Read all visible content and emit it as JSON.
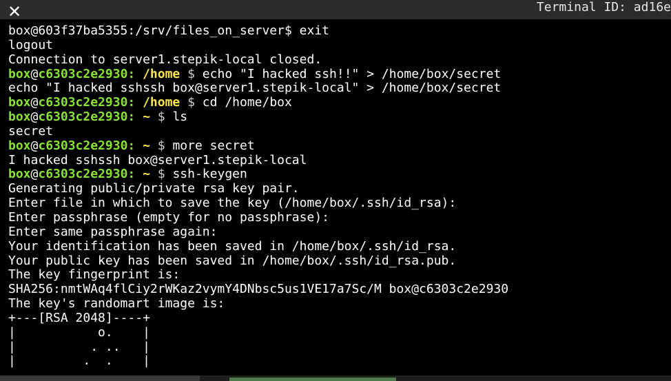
{
  "titlebar": {
    "close_symbol": "✕",
    "terminal_id": "Terminal ID: ad16e"
  },
  "terminal": {
    "lines": [
      {
        "plain": "box@603f37ba5355:/srv/files_on_server$ exit"
      },
      {
        "plain": "logout"
      },
      {
        "plain": "Connection to server1.stepik-local closed."
      },
      {
        "user": "box",
        "at": "@",
        "host": "c6303c2e2930:",
        "path": " /home",
        "sym": " $",
        "cmd": " echo \"I hacked ssh!!\" > /home/box/secret"
      },
      {
        "plain": "echo \"I hacked sshssh box@server1.stepik-local\" > /home/box/secret"
      },
      {
        "user": "box",
        "at": "@",
        "host": "c6303c2e2930:",
        "path": " /home",
        "sym": " $",
        "cmd": " cd /home/box"
      },
      {
        "user": "box",
        "at": "@",
        "host": "c6303c2e2930:",
        "path": " ~",
        "sym": " $",
        "cmd": " ls"
      },
      {
        "plain": "secret"
      },
      {
        "user": "box",
        "at": "@",
        "host": "c6303c2e2930:",
        "path": " ~",
        "sym": " $",
        "cmd": " more secret"
      },
      {
        "plain": "I hacked sshssh box@server1.stepik-local"
      },
      {
        "user": "box",
        "at": "@",
        "host": "c6303c2e2930:",
        "path": " ~",
        "sym": " $",
        "cmd": " ssh-keygen"
      },
      {
        "plain": "Generating public/private rsa key pair."
      },
      {
        "plain": "Enter file in which to save the key (/home/box/.ssh/id_rsa):"
      },
      {
        "plain": "Enter passphrase (empty for no passphrase):"
      },
      {
        "plain": "Enter same passphrase again:"
      },
      {
        "plain": "Your identification has been saved in /home/box/.ssh/id_rsa."
      },
      {
        "plain": "Your public key has been saved in /home/box/.ssh/id_rsa.pub."
      },
      {
        "plain": "The key fingerprint is:"
      },
      {
        "plain": "SHA256:nmtWAq4flCiy2rWKaz2vymY4DNbsc5us1VE17a7Sc/M box@c6303c2e2930"
      },
      {
        "plain": "The key's randomart image is:"
      },
      {
        "plain": "+---[RSA 2048]----+"
      },
      {
        "plain": "|           o.    |"
      },
      {
        "plain": "|          . ..   |"
      },
      {
        "plain": "|         .  .    |"
      }
    ]
  },
  "colors": {
    "background": "#000000",
    "prompt_user_host": "#8ae234",
    "prompt_path": "#fce94f",
    "text": "#ffffff"
  }
}
